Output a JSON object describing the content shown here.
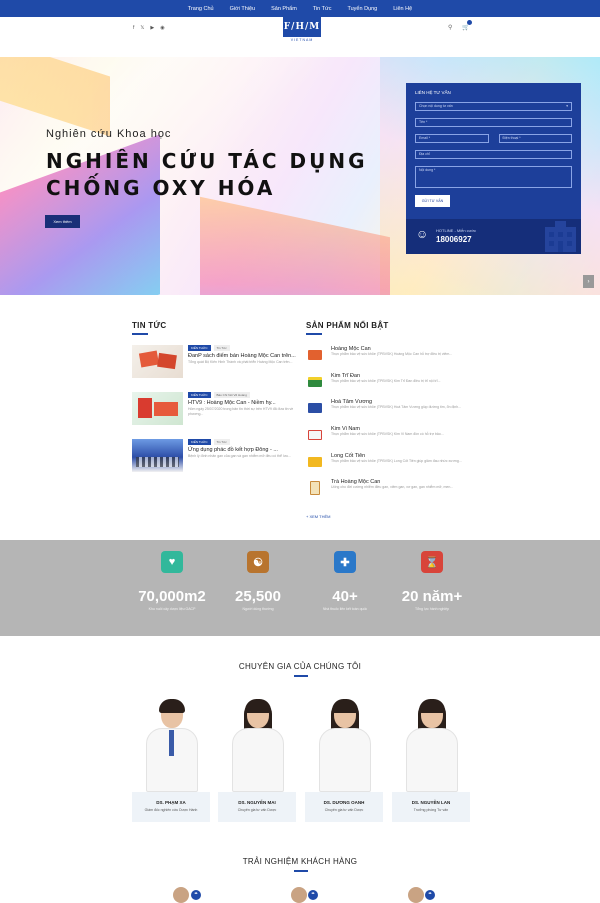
{
  "nav": {
    "items": [
      "Trang Chủ",
      "Giới Thiệu",
      "Sản Phẩm",
      "Tin Tức",
      "Tuyển Dụng",
      "Liên Hệ"
    ]
  },
  "header": {
    "logo_text": "F/H/M",
    "logo_sub": "VIETNAM",
    "social_icons": [
      "facebook-icon",
      "twitter-icon",
      "youtube-icon",
      "instagram-icon"
    ]
  },
  "hero": {
    "eyebrow": "Nghiên cứu Khoa học",
    "title_line1": "NGHIÊN CỨU TÁC DỤNG",
    "title_line2": "CHỐNG OXY HÓA",
    "button": "Xem thêm"
  },
  "contact_form": {
    "title": "LIÊN HỆ TƯ VẤN",
    "select_value": "Chọn nội dung tư vấn",
    "name_placeholder": "Tên *",
    "email_placeholder": "Email *",
    "phone_placeholder": "Điện thoại *",
    "address_placeholder": "Địa chỉ",
    "content_placeholder": "Nội dung *",
    "submit_label": "GỬI TƯ VẤN"
  },
  "hotline": {
    "label": "HOTLINE - Miễn cước",
    "number": "18006927"
  },
  "news": {
    "heading": "TIN TỨC",
    "items": [
      {
        "tag1": "KIẾN THỨC",
        "tag2": "Tin Tức",
        "title": "ĐanP sách điểm bán Hoàng Mộc Can trên...",
        "excerpt": "Tổng quát Bộ Kiến Hinh Thành và phát triển Hoàng Mộc Can trên...",
        "thumb_color": "#e45a3a"
      },
      {
        "tag1": "KIẾN THỨC",
        "tag2": "Báo Chí Nói Về Hoàng",
        "title": "HTV9 : Hoàng Mộc Can - Niềm hy...",
        "excerpt": "Hôm ngày 25/07/2020 trong bản tin thời sự trên HTV9 đã đưa tin về phương...",
        "thumb_color": "#d93b2f"
      },
      {
        "tag1": "KIẾN THỨC",
        "tag2": "Tin Tức",
        "title": "Ứng dụng phác đồ kết hợp Đông - ...",
        "excerpt": "Bệnh lý đình nhân gan của gan và gan nhiễm mỡ đều có thể lưu...",
        "thumb_color": "#2d4ea8"
      }
    ]
  },
  "products": {
    "heading": "SẢN PHẨM NỔI BẬT",
    "see_more": "+ XEM THÊM",
    "items": [
      {
        "name": "Hoàng Mộc Can",
        "excerpt": "Thực phẩm bảo vệ sức khỏe (TPBVSK) Hoàng Mộc Can hỗ trợ điều trị viêm...",
        "color": "#e2612f"
      },
      {
        "name": "Kim Trĩ Đan",
        "excerpt": "Thực phẩm bảo vệ sức khỏe (TPBVSK) Kim Trĩ Đan điều trị trĩ nội trĩ...",
        "color": "#2f8a3e"
      },
      {
        "name": "Hoá Tâm Vương",
        "excerpt": "Thực phẩm bảo vệ sức khỏe (TPBVSK) Hoá Tâm Vương giúp đường tim, ổn định...",
        "color": "#2b4ea5"
      },
      {
        "name": "Kim Vi Nam",
        "excerpt": "Thực phẩm bảo vệ sức khỏe (TPBVSK) Kim Vi Nam đồn có hỗ trợ bảo...",
        "color": "#d8443a"
      },
      {
        "name": "Long Cốt Tiên",
        "excerpt": "Thực phẩm bảo vệ sức khỏe (TPBVSK) Long Cốt Tiên giúp giảm đau nhức xương...",
        "color": "#f2b820"
      },
      {
        "name": "Trà Hoàng Mộc Can",
        "excerpt": "Uống cho đời cường nhiễm điều gan, viêm gan, xơ gan, gan nhiễm mỡ, men...",
        "color": "#c98b3c"
      }
    ]
  },
  "stats": [
    {
      "value": "70,000m2",
      "label": "Khu nuôi cây dược liệu GACP",
      "icon": "health-icon",
      "color": "#32b89b"
    },
    {
      "value": "25,500",
      "label": "Người dùng thường",
      "icon": "care-icon",
      "color": "#b8742e"
    },
    {
      "value": "40+",
      "label": "Nhà thuốc liên kết toàn quốc",
      "icon": "medkit-icon",
      "color": "#2a78c9"
    },
    {
      "value": "20 năm+",
      "label": "Tổng lực hành nghiệp",
      "icon": "hourglass-icon",
      "color": "#d8443a"
    }
  ],
  "experts": {
    "heading": "CHUYÊN GIA CỦA CHÚNG TÔI",
    "people": [
      {
        "name": "DS. PHẠM XA",
        "role": "Giám đốc nghiên cứu Dược Hành"
      },
      {
        "name": "DS. NGUYỄN MAI",
        "role": "Chuyên gia tư vấn Dược"
      },
      {
        "name": "DS. DƯƠNG OANH",
        "role": "Chuyên gia tư vấn Dược"
      },
      {
        "name": "DS. NGUYỄN LAN",
        "role": "Trưởng phòng Tư vấn"
      }
    ]
  },
  "testimonials": {
    "heading": "TRẢI NGHIỆM KHÁCH HÀNG",
    "quote_glyph": "“"
  }
}
